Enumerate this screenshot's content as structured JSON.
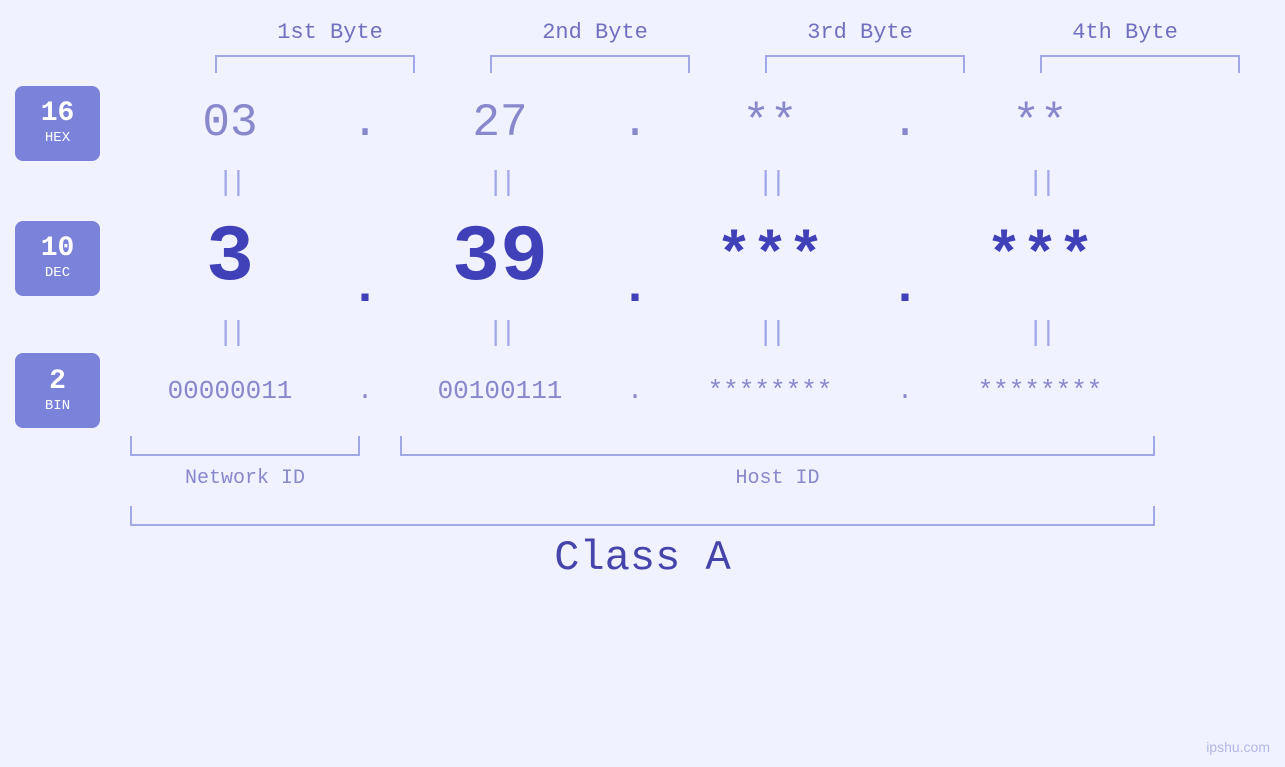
{
  "headers": {
    "col1": "1st Byte",
    "col2": "2nd Byte",
    "col3": "3rd Byte",
    "col4": "4th Byte"
  },
  "hex_row": {
    "val1": "03",
    "val2": "27",
    "val3": "**",
    "val4": "**",
    "dot": "."
  },
  "dec_row": {
    "val1": "3",
    "val2": "39",
    "val3": "***",
    "val4": "***",
    "dot": "."
  },
  "bin_row": {
    "val1": "00000011",
    "val2": "00100111",
    "val3": "********",
    "val4": "********",
    "dot": "."
  },
  "badges": {
    "hex": {
      "number": "16",
      "name": "HEX"
    },
    "dec": {
      "number": "10",
      "name": "DEC"
    },
    "bin": {
      "number": "2",
      "name": "BIN"
    }
  },
  "labels": {
    "network_id": "Network ID",
    "host_id": "Host ID",
    "class": "Class A"
  },
  "watermark": "ipshu.com",
  "equals": "||"
}
